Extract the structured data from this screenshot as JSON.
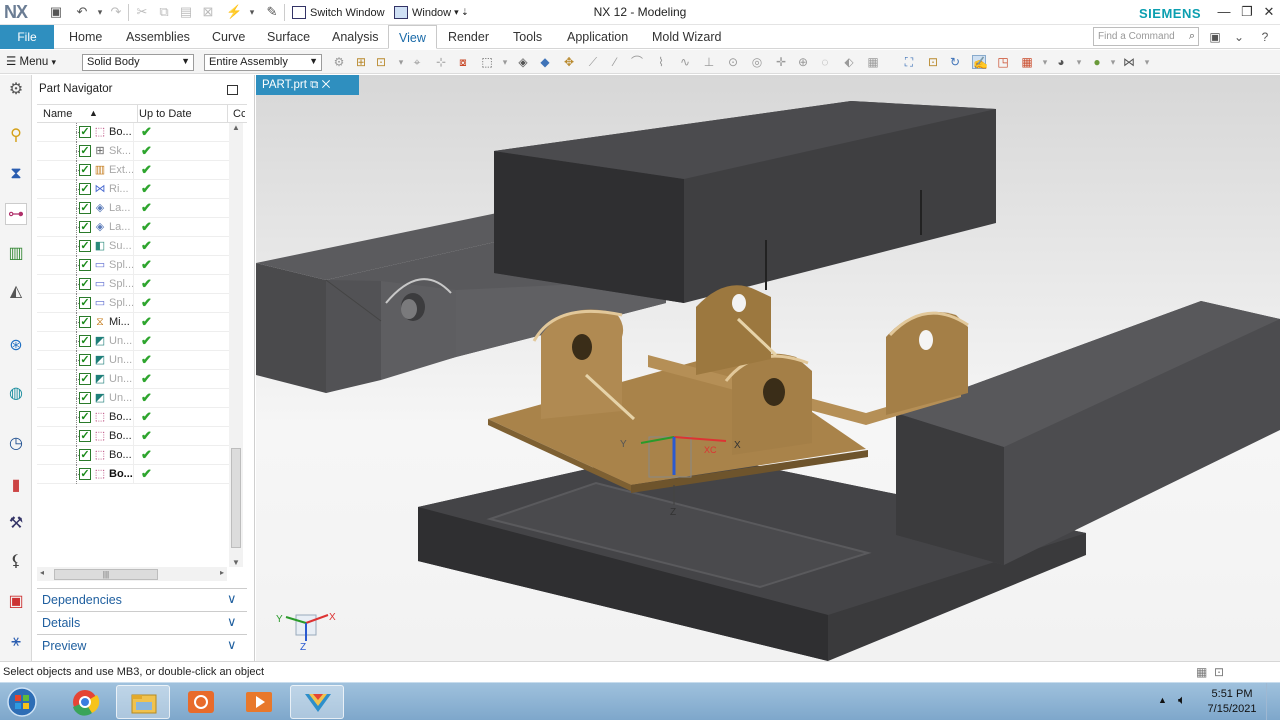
{
  "title_bar": {
    "logo": "NX",
    "app_title": "NX 12 - Modeling",
    "switch_window": "Switch Window",
    "window_menu": "Window",
    "brand": "SIEMENS"
  },
  "ribbon": {
    "file": "File",
    "tabs": [
      "Home",
      "Assemblies",
      "Curve",
      "Surface",
      "Analysis",
      "View",
      "Render",
      "Tools",
      "Application",
      "Mold Wizard"
    ],
    "active_tab": "View",
    "find_placeholder": "Find a Command"
  },
  "toolbar": {
    "menu": "Menu",
    "selection_filter": "Solid Body",
    "selection_scope": "Entire Assembly"
  },
  "navigator": {
    "title": "Part Navigator",
    "columns": [
      "Name",
      "Up to Date",
      "Cc"
    ],
    "items": [
      {
        "label": "Bo...",
        "icon": "body-icon",
        "state": "normal"
      },
      {
        "label": "Sk...",
        "icon": "sketch-icon",
        "state": "dim"
      },
      {
        "label": "Ext...",
        "icon": "extrude-icon",
        "state": "dim"
      },
      {
        "label": "Ri...",
        "icon": "rib-icon",
        "state": "dim"
      },
      {
        "label": "La...",
        "icon": "law-icon",
        "state": "dim"
      },
      {
        "label": "La...",
        "icon": "law-icon",
        "state": "dim"
      },
      {
        "label": "Su...",
        "icon": "sub-icon",
        "state": "dim"
      },
      {
        "label": "Spl...",
        "icon": "split-icon",
        "state": "dim"
      },
      {
        "label": "Spl...",
        "icon": "split-icon",
        "state": "dim"
      },
      {
        "label": "Spl...",
        "icon": "split-icon",
        "state": "dim"
      },
      {
        "label": "Mi...",
        "icon": "mirror-icon",
        "state": "normal"
      },
      {
        "label": "Un...",
        "icon": "unite-icon",
        "state": "dim"
      },
      {
        "label": "Un...",
        "icon": "unite-icon",
        "state": "dim"
      },
      {
        "label": "Un...",
        "icon": "unite-icon",
        "state": "dim"
      },
      {
        "label": "Un...",
        "icon": "unite-icon",
        "state": "dim"
      },
      {
        "label": "Bo...",
        "icon": "body-icon",
        "state": "normal"
      },
      {
        "label": "Bo...",
        "icon": "body-icon",
        "state": "normal"
      },
      {
        "label": "Bo...",
        "icon": "body-icon",
        "state": "normal"
      },
      {
        "label": "Bo...",
        "icon": "body-icon",
        "state": "bold"
      }
    ],
    "panels": [
      "Dependencies",
      "Details",
      "Preview"
    ]
  },
  "document": {
    "tab": "PART.prt"
  },
  "viewport": {
    "triad_labels": {
      "x": "X",
      "y": "Y",
      "z": "Z"
    },
    "csys_labels": {
      "xc": "XC",
      "x": "X",
      "y": "Y",
      "z": "Z"
    }
  },
  "status": {
    "message": "Select objects and use MB3, or double-click an object"
  },
  "taskbar": {
    "time": "5:51 PM",
    "date": "7/15/2021"
  }
}
